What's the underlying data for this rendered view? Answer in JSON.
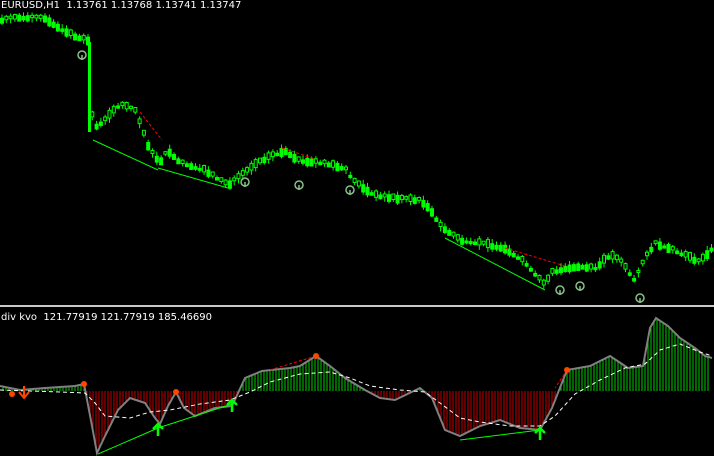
{
  "window": {
    "symbol": "EURUSD,H1",
    "ohlc": "1.13761 1.13768 1.13741 1.13747"
  },
  "indicator": {
    "name": "div kvo",
    "values": "121.77919 121.77919 185.46690"
  },
  "colors": {
    "background": "#000000",
    "candle": "#00ff00",
    "histogram_positive": "#00ff00",
    "histogram_negative": "#ff0000",
    "kvo_line": "#808080",
    "signal_line": "#ffffff",
    "divergence_bull": "#00ff00",
    "divergence_bear": "#ff0000",
    "arrow_up": "#00ff00",
    "marker_dot": "#ff4500",
    "separator": "#c8c8c8"
  },
  "icons": {
    "bullish_signal": "up-arrow-icon",
    "bearish_signal": "down-arrow-icon"
  }
}
